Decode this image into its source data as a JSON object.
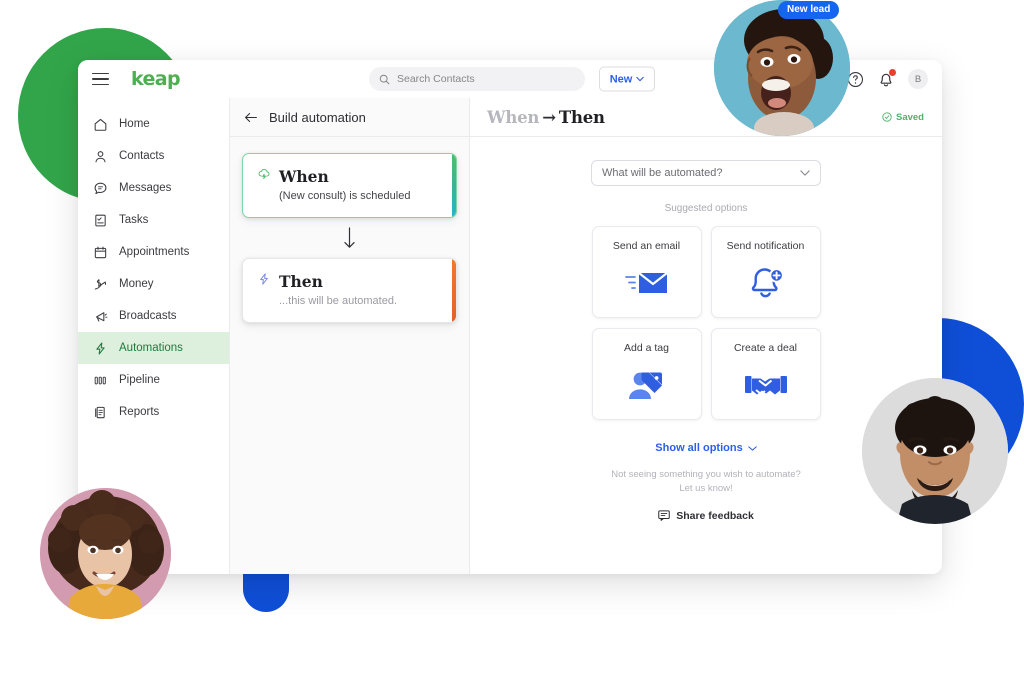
{
  "app": {
    "brand": "keap",
    "hamburger_icon": "hamburger-menu-icon"
  },
  "topbar": {
    "search_placeholder": "Search Contacts",
    "search_value": "",
    "search_icon": "search-icon",
    "new_button": "New",
    "new_chevron_icon": "chevron-down-icon",
    "help_icon": "help-circle-icon",
    "notification_icon": "bell-icon",
    "notification_has_alert": true,
    "avatar_initial": "B"
  },
  "sidebar": {
    "items": [
      {
        "label": "Home",
        "icon": "home-icon",
        "active": false
      },
      {
        "label": "Contacts",
        "icon": "person-icon",
        "active": false
      },
      {
        "label": "Messages",
        "icon": "chat-bubble-icon",
        "active": false
      },
      {
        "label": "Tasks",
        "icon": "checklist-icon",
        "active": false
      },
      {
        "label": "Appointments",
        "icon": "calendar-icon",
        "active": false
      },
      {
        "label": "Money",
        "icon": "money-trend-icon",
        "active": false
      },
      {
        "label": "Broadcasts",
        "icon": "megaphone-icon",
        "active": false
      },
      {
        "label": "Automations",
        "icon": "lightning-bolt-icon",
        "active": true
      },
      {
        "label": "Pipeline",
        "icon": "pipeline-bars-icon",
        "active": false
      },
      {
        "label": "Reports",
        "icon": "report-document-icon",
        "active": false
      }
    ]
  },
  "builder": {
    "header": "Build automation",
    "back_icon": "arrow-left-icon",
    "when_card": {
      "icon": "cloud-lightning-icon",
      "title": "When",
      "subtitle": "(New consult) is scheduled",
      "edge_color_start": "#4cbf6b",
      "edge_color_end": "#29b5c9"
    },
    "connector_icon": "arrow-down-icon",
    "then_card": {
      "icon": "lightning-bolt-icon",
      "title": "Then",
      "subtitle": "...this will be automated.",
      "edge_color": "#e2622a"
    }
  },
  "detail": {
    "title_when": "When",
    "title_arrow": "→",
    "title_then": "Then",
    "saved_label": "Saved",
    "saved_icon": "check-circle-icon",
    "saved_color": "#52b06a",
    "select_placeholder": "What will be automated?",
    "select_chevron_icon": "chevron-down-icon",
    "suggested_label": "Suggested options",
    "options": [
      {
        "label": "Send an email",
        "icon": "envelope-icon"
      },
      {
        "label": "Send notification",
        "icon": "bell-plus-icon"
      },
      {
        "label": "Add a tag",
        "icon": "person-tag-icon"
      },
      {
        "label": "Create a deal",
        "icon": "handshake-icon"
      }
    ],
    "show_all": "Show all options",
    "show_all_chevron_icon": "chevron-down-icon",
    "not_seeing_line1": "Not seeing something you wish to automate?",
    "not_seeing_line2": "Let us know!",
    "share_feedback": "Share feedback",
    "share_feedback_icon": "feedback-comment-icon"
  },
  "decor": {
    "new_lead_badge": "New lead",
    "badge_color": "#1565f0",
    "green_circle_color": "#32a54a",
    "blue_shape_color": "#0f4fd8",
    "photo_top_bg": "#6cb8cf",
    "photo_left_bg": "#d7a0b4",
    "photo_right_bg": "#dcdcdc"
  }
}
